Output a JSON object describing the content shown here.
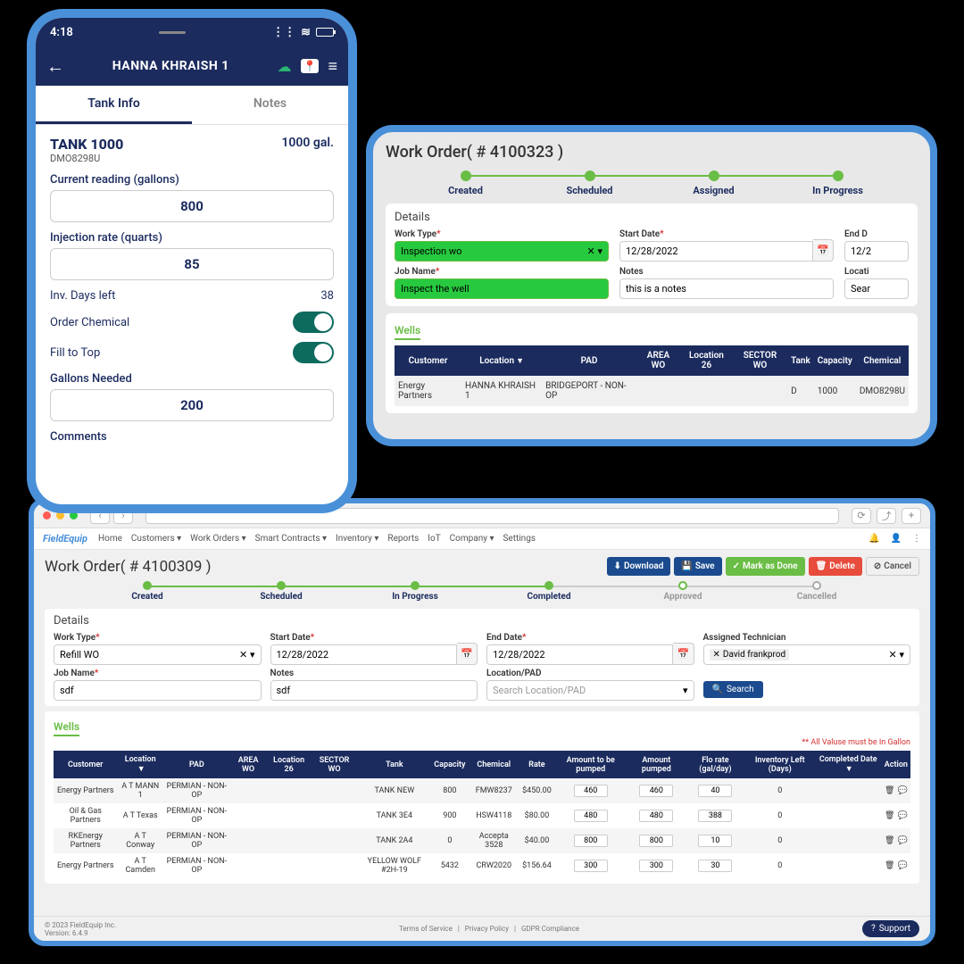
{
  "phone": {
    "time": "4:18",
    "title": "HANNA KHRAISH 1",
    "tabs": {
      "info": "Tank Info",
      "notes": "Notes"
    },
    "tank_name": "TANK 1000",
    "tank_id": "DMO8298U",
    "capacity": "1000 gal.",
    "labels": {
      "current": "Current reading (gallons)",
      "injection": "Injection rate (quarts)",
      "inv": "Inv. Days left",
      "order": "Order Chemical",
      "fill": "Fill to Top",
      "gallons": "Gallons Needed",
      "comments": "Comments"
    },
    "values": {
      "current": "800",
      "injection": "85",
      "inv": "38",
      "gallons": "200"
    }
  },
  "tablet": {
    "title": "Work Order( # 4100323 )",
    "steps": [
      "Created",
      "Scheduled",
      "Assigned",
      "In Progress"
    ],
    "details_title": "Details",
    "labels": {
      "work_type": "Work Type",
      "start": "Start Date",
      "end": "End D",
      "job": "Job Name",
      "notes": "Notes",
      "location": "Locati"
    },
    "values": {
      "work_type": "Inspection wo",
      "start": "12/28/2022",
      "end": "12/2",
      "job": "Inspect the well",
      "notes": "this is a notes",
      "loc_ph": "Sear"
    },
    "wells": "Wells",
    "table": {
      "headers": [
        "Customer",
        "Location",
        "PAD",
        "AREA WO",
        "Location 26",
        "SECTOR WO",
        "Tank",
        "Capacity",
        "Chemical"
      ],
      "row": [
        "Energy Partners",
        "HANNA KHRAISH 1",
        "BRIDGEPORT - NON-OP",
        "",
        "",
        "",
        "D",
        "1000",
        "DMO8298U"
      ]
    }
  },
  "desktop": {
    "logo": "FieldEquip",
    "nav": [
      "Home",
      "Customers ▾",
      "Work Orders ▾",
      "Smart Contracts ▾",
      "Inventory ▾",
      "Reports",
      "IoT",
      "Company ▾",
      "Settings"
    ],
    "title": "Work Order( # 4100309 )",
    "buttons": {
      "download": "Download",
      "save": "Save",
      "mark": "Mark as Done",
      "delete": "Delete",
      "cancel": "Cancel"
    },
    "steps": [
      "Created",
      "Scheduled",
      "In Progress",
      "Completed",
      "Approved",
      "Cancelled"
    ],
    "details": "Details",
    "labels": {
      "work_type": "Work Type",
      "start": "Start Date",
      "end": "End Date",
      "tech": "Assigned Technician",
      "job": "Job Name",
      "notes": "Notes",
      "loc": "Location/PAD"
    },
    "values": {
      "work_type": "Refill WO",
      "start": "12/28/2022",
      "end": "12/28/2022",
      "tech": "David frankprod",
      "job": "sdf",
      "notes": "sdf",
      "loc_ph": "Search Location/PAD",
      "search": "Search"
    },
    "wells": "Wells",
    "table_note": "** All Valuse must be In Gallon",
    "headers": [
      "Customer",
      "Location",
      "PAD",
      "AREA WO",
      "Location 26",
      "SECTOR WO",
      "Tank",
      "Capacity",
      "Chemical",
      "Rate",
      "Amount to be pumped",
      "Amount pumped",
      "Flo rate (gal/day)",
      "Inventory Left (Days)",
      "Completed Date",
      "Action"
    ],
    "rows": [
      {
        "c": "Energy Partners",
        "l": "A T MANN 1",
        "p": "PERMIAN - NON-OP",
        "t": "TANK NEW",
        "cap": "800",
        "ch": "FMW8237",
        "r": "$450.00",
        "a1": "460",
        "a2": "460",
        "f": "40",
        "i": "0"
      },
      {
        "c": "Oil & Gas Partners",
        "l": "A T Texas",
        "p": "PERMIAN - NON-OP",
        "t": "TANK 3E4",
        "cap": "900",
        "ch": "HSW4118",
        "r": "$80.00",
        "a1": "480",
        "a2": "480",
        "f": "388",
        "i": "0"
      },
      {
        "c": "RKEnergy Partners",
        "l": "A T Conway",
        "p": "PERMIAN - NON-OP",
        "t": "TANK 2A4",
        "cap": "0",
        "ch": "Accepta 3528",
        "r": "$40.00",
        "a1": "800",
        "a2": "800",
        "f": "10",
        "i": "0"
      },
      {
        "c": "Energy Partners",
        "l": "A T Camden",
        "p": "PERMIAN - NON-OP",
        "t": "YELLOW WOLF #2H-19",
        "cap": "5432",
        "ch": "CRW2020",
        "r": "$156.64",
        "a1": "300",
        "a2": "300",
        "f": "30",
        "i": "0"
      }
    ],
    "footer": {
      "copy": "© 2023 FieldEquip Inc.",
      "ver": "Version: 6.4.9",
      "links": [
        "Terms of Service",
        "Privacy Policy",
        "GDPR Compliance"
      ],
      "support": "Support"
    }
  }
}
